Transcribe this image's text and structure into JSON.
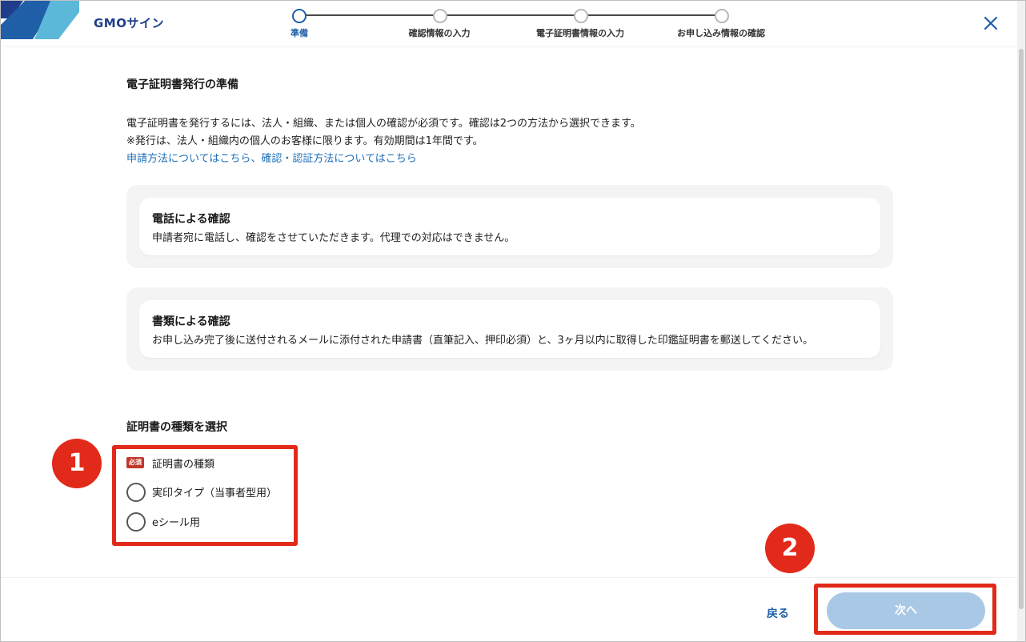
{
  "header": {
    "logo_text": "GMOサイン",
    "steps": [
      {
        "label": "準備",
        "active": true
      },
      {
        "label": "確認情報の入力",
        "active": false
      },
      {
        "label": "電子証明書情報の入力",
        "active": false
      },
      {
        "label": "お申し込み情報の確認",
        "active": false
      }
    ],
    "close_icon": "close-icon"
  },
  "main": {
    "title": "電子証明書発行の準備",
    "description_line1": "電子証明書を発行するには、法人・組織、または個人の確認が必須です。確認は2つの方法から選択できます。",
    "description_line2": "※発行は、法人・組織内の個人のお客様に限ります。有効期間は1年間です。",
    "link_text": "申請方法についてはこちら、確認・認証方法についてはこちら",
    "methods": [
      {
        "title": "電話による確認",
        "text": "申請者宛に電話し、確認をさせていただきます。代理での対応はできません。"
      },
      {
        "title": "書類による確認",
        "text": "お申し込み完了後に送付されるメールに添付された申請書（直筆記入、押印必須）と、3ヶ月以内に取得した印鑑証明書を郵送してください。"
      }
    ],
    "cert_section_title": "証明書の種類を選択",
    "required_label": "必須",
    "cert_field_label": "証明書の種類",
    "options": [
      {
        "label": "実印タイプ（当事者型用）",
        "selected": false
      },
      {
        "label": "eシール用",
        "selected": false
      }
    ]
  },
  "annotations": {
    "badge1": "1",
    "badge2": "2",
    "highlight_color": "#e22a1a"
  },
  "footer": {
    "back_label": "戻る",
    "next_label": "次へ"
  },
  "colors": {
    "brand": "#1f5fa8",
    "link": "#1f6fb8",
    "next_button_disabled": "#a9c8e6",
    "required_badge": "#c0392b"
  }
}
